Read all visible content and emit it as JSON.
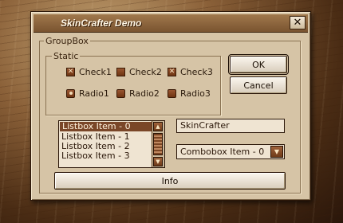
{
  "window": {
    "title": "SkinCrafter Demo",
    "close_symbol": "✕"
  },
  "groupbox": {
    "label": "GroupBox"
  },
  "static": {
    "label": "Static"
  },
  "checks": [
    {
      "label": "Check1",
      "checked": true
    },
    {
      "label": "Check2",
      "checked": false
    },
    {
      "label": "Check3",
      "checked": true
    }
  ],
  "radios": [
    {
      "label": "Radio1",
      "selected": true
    },
    {
      "label": "Radio2",
      "selected": false
    },
    {
      "label": "Radio3",
      "selected": false
    }
  ],
  "buttons": {
    "ok": "OK",
    "cancel": "Cancel",
    "info": "Info"
  },
  "listbox": {
    "items": [
      "Listbox Item - 0",
      "Listbox Item - 1",
      "Listbox Item - 2",
      "Listbox Item - 3"
    ],
    "selected_index": 0
  },
  "textfield": {
    "value": "SkinCrafter"
  },
  "combobox": {
    "value": "Combobox Item - 0"
  },
  "colors": {
    "accent": "#7a4628",
    "window_bg": "#d6c4a6",
    "titlebar": "#8a6238"
  }
}
